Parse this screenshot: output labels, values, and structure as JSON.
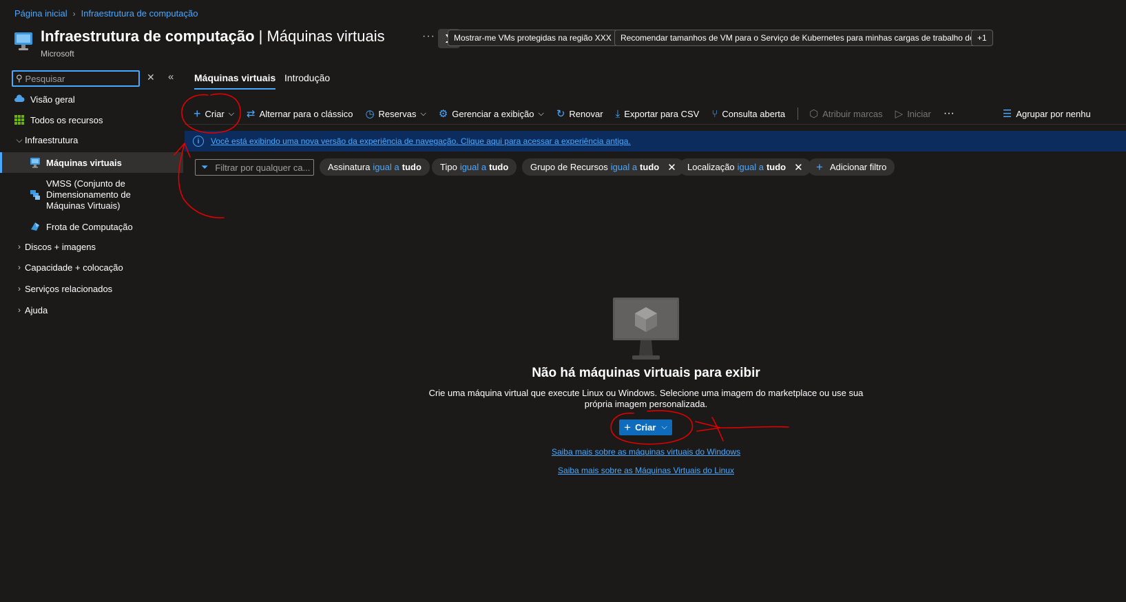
{
  "breadcrumb": {
    "home": "Página inicial",
    "current": "Infraestrutura de computação"
  },
  "header": {
    "title": "Infraestrutura de computação",
    "title_separator": "| Máquinas virtuais",
    "subtitle": "Microsoft",
    "more": "···",
    "suggestion_chips": [
      "Mostrar-me VMs protegidas na região XXX",
      "Recomendar tamanhos de VM para o Serviço de Kubernetes para minhas cargas de trabalho de IA",
      "+1"
    ]
  },
  "sidebar": {
    "search_placeholder": "Pesquisar",
    "items": [
      {
        "label": "Visão geral",
        "icon": "cloud-icon"
      },
      {
        "label": "Todos os recursos",
        "icon": "grid-icon"
      },
      {
        "label": "Infraestrutura",
        "expanded": true
      },
      {
        "label": "Máquinas virtuais",
        "icon": "vm-icon",
        "selected": true
      },
      {
        "label_lines": [
          "VMSS (Conjunto de",
          "Dimensionamento de",
          "Máquinas Virtuais)"
        ],
        "icon": "vmss-icon"
      },
      {
        "label": "Frota de Computação",
        "icon": "fleet-icon"
      },
      {
        "label": "Discos + imagens",
        "expanded": false
      },
      {
        "label": "Capacidade + colocação",
        "expanded": false
      },
      {
        "label": "Serviços relacionados",
        "expanded": false
      },
      {
        "label": "Ajuda",
        "expanded": false
      }
    ]
  },
  "tabs": [
    "Máquinas virtuais",
    "Introdução"
  ],
  "toolbar": {
    "create": "Criar",
    "switch_classic": "Alternar para o clássico",
    "reservations": "Reservas",
    "manage_view": "Gerenciar a exibição",
    "refresh": "Renovar",
    "export_csv": "Exportar para CSV",
    "open_query": "Consulta aberta",
    "assign_tags": "Atribuir marcas",
    "start": "Iniciar",
    "more": "···",
    "group_by": "Agrupar por nenhu"
  },
  "banner": {
    "text": "Você está exibindo uma nova versão da experiência de navegação. Clique aqui para acessar a experiência antiga."
  },
  "filters": {
    "placeholder": "Filtrar por qualquer ca...",
    "pills": [
      {
        "field": "Assinatura",
        "op": "igual a",
        "value": "tudo",
        "removable": false
      },
      {
        "field": "Tipo",
        "op": "igual a",
        "value": "tudo",
        "removable": false
      },
      {
        "field": "Grupo de Recursos",
        "op": "igual a",
        "value": "tudo",
        "removable": true
      },
      {
        "field": "Localização",
        "op": "igual a",
        "value": "tudo",
        "removable": true
      }
    ],
    "add_filter": "Adicionar filtro"
  },
  "empty_state": {
    "title": "Não há máquinas virtuais para exibir",
    "description": "Crie uma máquina virtual que execute Linux ou Windows. Selecione uma imagem do marketplace ou use sua própria imagem personalizada.",
    "create_button": "Criar",
    "link_windows": "Saiba mais sobre as máquinas virtuais do Windows",
    "link_linux": "Saiba mais sobre as Máquinas Virtuais do Linux"
  },
  "colors": {
    "background": "#1b1a19",
    "accent": "#4aa8ff",
    "primary_button": "#0f6cbd",
    "banner": "#0b2c5c",
    "annotation": "#e00000"
  }
}
